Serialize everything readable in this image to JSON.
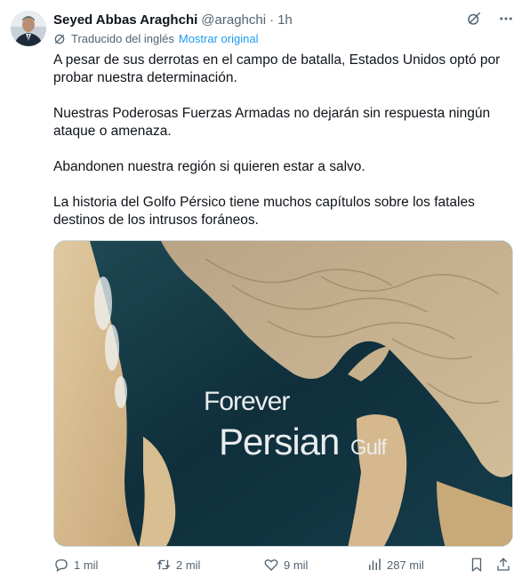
{
  "tweet": {
    "author_name": "Seyed Abbas Araghchi",
    "handle": "@araghchi",
    "separator": "·",
    "time": "1h",
    "translated_label": "Traducido del inglés",
    "show_original": "Mostrar original",
    "paragraphs": [
      "A pesar de sus derrotas en el campo de batalla, Estados Unidos optó por probar nuestra determinación.",
      "Nuestras Poderosas Fuerzas Armadas no dejarán sin respuesta ningún ataque o amenaza.",
      "Abandonen nuestra región si quieren estar a salvo.",
      "La historia del Golfo Pérsico tiene muchos capítulos sobre los fatales destinos de los intrusos foráneos."
    ],
    "image_text": {
      "line1": "Forever",
      "line2_big": "Persian",
      "line2_small": "Gulf"
    }
  },
  "actions": {
    "replies": "1 mil",
    "reposts": "2 mil",
    "likes": "9 mil",
    "views": "287 mil"
  },
  "icons": {
    "grok": "grok-icon",
    "more": "more-icon",
    "translate": "translate-icon",
    "reply": "reply-icon",
    "repost": "repost-icon",
    "like": "like-icon",
    "views": "views-icon",
    "bookmark": "bookmark-icon",
    "share": "share-icon"
  },
  "colors": {
    "link": "#1d9bf0",
    "secondary": "#536471",
    "text": "#0f1419"
  }
}
